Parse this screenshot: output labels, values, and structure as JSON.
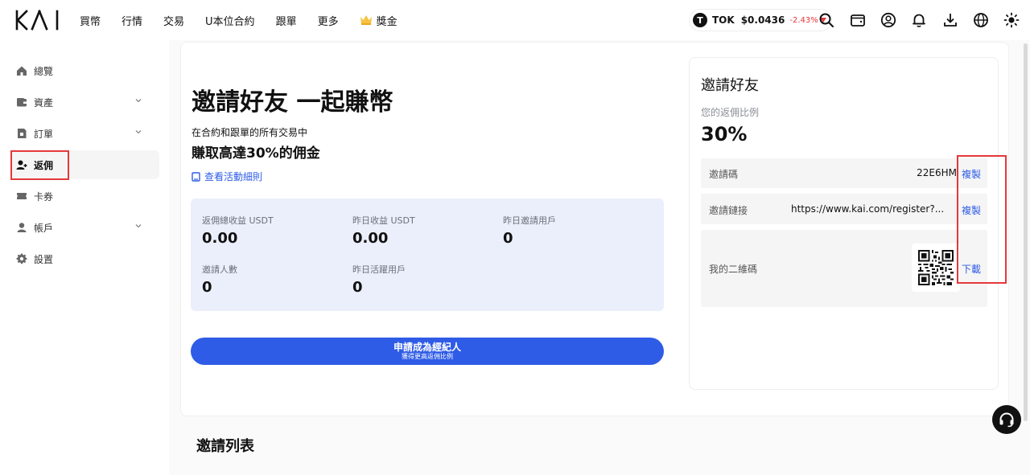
{
  "brand": {
    "logo_text": "KAI"
  },
  "nav": {
    "items": [
      {
        "label": "買幣"
      },
      {
        "label": "行情"
      },
      {
        "label": "交易"
      },
      {
        "label": "U本位合約"
      },
      {
        "label": "跟單"
      },
      {
        "label": "更多"
      },
      {
        "label": "獎金",
        "icon": "crown-icon"
      }
    ]
  },
  "ticker": {
    "symbol": "TOK",
    "icon_letter": "T",
    "price": "$0.0436",
    "change": "-2.43%",
    "change_color": "#e5383b"
  },
  "header_icons": [
    "search-icon",
    "wallet-icon",
    "user-icon",
    "bell-icon",
    "download-icon",
    "globe-icon",
    "sun-icon"
  ],
  "sidebar": {
    "items": [
      {
        "label": "總覽",
        "icon": "home-icon"
      },
      {
        "label": "資產",
        "icon": "wallet-icon",
        "expandable": true
      },
      {
        "label": "訂單",
        "icon": "order-icon",
        "expandable": true
      },
      {
        "label": "返佣",
        "icon": "user-add-icon",
        "active": true
      },
      {
        "label": "卡券",
        "icon": "ticket-icon"
      },
      {
        "label": "帳戶",
        "icon": "person-icon",
        "expandable": true
      },
      {
        "label": "設置",
        "icon": "gear-icon"
      }
    ]
  },
  "hero": {
    "title": "邀請好友 一起賺幣",
    "subtitle_line1": "在合約和跟單的所有交易中",
    "subtitle_line2": "賺取高達30%的佣金",
    "rules_link": "查看活動細則"
  },
  "stats": [
    {
      "label": "返佣總收益 USDT",
      "value": "0.00"
    },
    {
      "label": "昨日收益 USDT",
      "value": "0.00"
    },
    {
      "label": "昨日邀請用戶",
      "value": "0"
    },
    {
      "label": "邀請人數",
      "value": "0"
    },
    {
      "label": "昨日活躍用戶",
      "value": "0"
    }
  ],
  "apply_button": {
    "label": "申請成為經紀人",
    "sublabel": "獲得更高返佣比例"
  },
  "invite": {
    "title": "邀請好友",
    "ratio_label": "您的返佣比例",
    "ratio": "30%",
    "code_label": "邀請碼",
    "code": "22E6HM",
    "code_action": "複製",
    "link_label": "邀請鏈接",
    "link": "https://www.kai.com/register?...",
    "link_action": "複製",
    "qr_label": "我的二維碼",
    "qr_action": "下載"
  },
  "list": {
    "title": "邀請列表"
  },
  "colors": {
    "accent": "#2f5ce6",
    "highlight": "#e5383b",
    "stats_bg": "#ebeffb"
  }
}
